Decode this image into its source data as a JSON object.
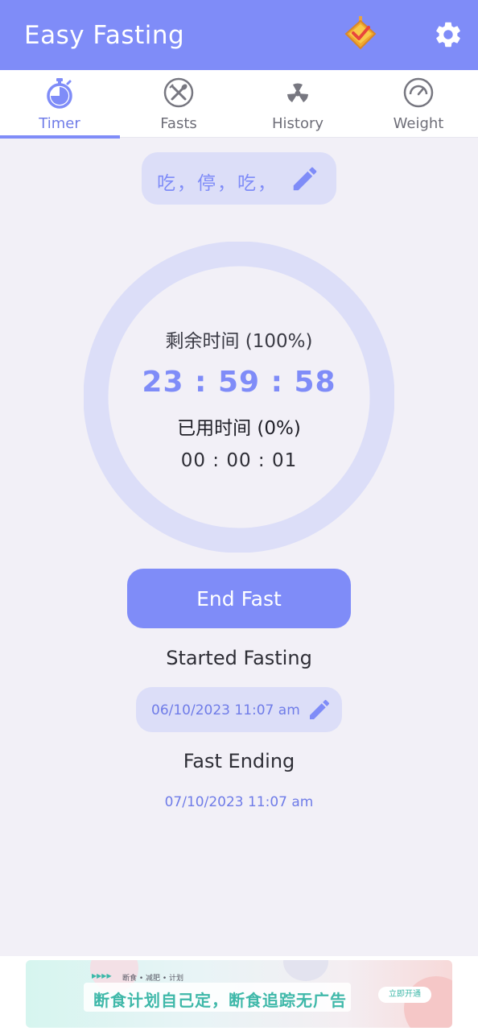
{
  "app": {
    "title": "Easy Fasting"
  },
  "tabs": [
    {
      "label": "Timer",
      "active": true
    },
    {
      "label": "Fasts",
      "active": false
    },
    {
      "label": "History",
      "active": false
    },
    {
      "label": "Weight",
      "active": false
    }
  ],
  "plan": {
    "name": "吃，停，吃，"
  },
  "timer": {
    "remaining_label": "剩余时间 (100%)",
    "remaining_time": "23 : 59 : 58",
    "elapsed_label": "已用时间 (0%)",
    "elapsed_time": "00 : 00 : 01",
    "progress": 0
  },
  "actions": {
    "end_fast": "End Fast"
  },
  "schedule": {
    "started_label": "Started Fasting",
    "started_value": "06/10/2023 11:07 am",
    "ending_label": "Fast Ending",
    "ending_value": "07/10/2023 11:07 am"
  },
  "ad": {
    "tagline": "断食 • 减肥 • 计划",
    "headline": "断食计划自己定，断食追踪无广告",
    "cta": "立即开通"
  },
  "colors": {
    "accent": "#7f8cf8",
    "accent_light": "#dcdef8",
    "background": "#f2f0f7"
  },
  "icons": {
    "premium": "premium-badge-icon",
    "settings": "gear-icon",
    "timer": "stopwatch-icon",
    "fasts": "fork-knife-icon",
    "history": "radiation-icon",
    "weight": "scale-gauge-icon",
    "edit": "pencil-icon"
  }
}
